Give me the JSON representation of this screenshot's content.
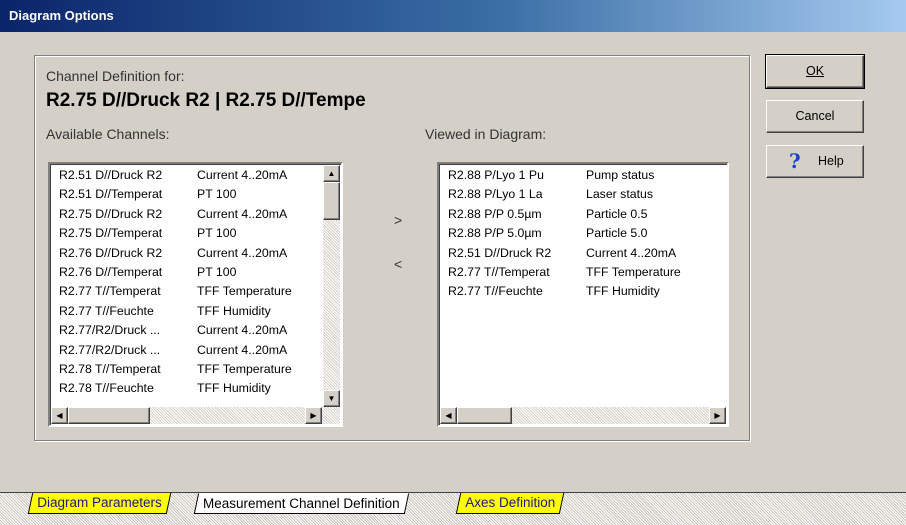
{
  "window": {
    "title": "Diagram Options"
  },
  "definition": {
    "label": "Channel Definition for:",
    "heading": "R2.75 D//Druck R2 | R2.75 D//Tempe"
  },
  "available": {
    "label": "Available Channels:",
    "rows": [
      {
        "name": "R2.51 D//Druck R2",
        "type": "Current 4..20mA"
      },
      {
        "name": "R2.51 D//Temperat",
        "type": "PT 100"
      },
      {
        "name": "R2.75 D//Druck R2",
        "type": "Current 4..20mA"
      },
      {
        "name": "R2.75 D//Temperat",
        "type": "PT 100"
      },
      {
        "name": "R2.76 D//Druck R2",
        "type": "Current 4..20mA"
      },
      {
        "name": "R2.76 D//Temperat",
        "type": "PT 100"
      },
      {
        "name": "R2.77 T//Temperat",
        "type": "TFF Temperature"
      },
      {
        "name": "R2.77 T//Feuchte",
        "type": "TFF Humidity"
      },
      {
        "name": "R2.77/R2/Druck ...",
        "type": "Current 4..20mA"
      },
      {
        "name": "R2.77/R2/Druck ...",
        "type": "Current 4..20mA"
      },
      {
        "name": "R2.78 T//Temperat",
        "type": "TFF Temperature"
      },
      {
        "name": "R2.78 T//Feuchte",
        "type": "TFF Humidity"
      }
    ]
  },
  "viewed": {
    "label": "Viewed in Diagram:",
    "rows": [
      {
        "name": "R2.88 P/Lyo 1 Pu",
        "type": "Pump status"
      },
      {
        "name": "R2.88 P/Lyo 1 La",
        "type": "Laser status"
      },
      {
        "name": "R2.88 P/P 0.5µm",
        "type": "Particle 0.5"
      },
      {
        "name": "R2.88 P/P 5.0µm",
        "type": "Particle 5.0"
      },
      {
        "name": "R2.51 D//Druck R2",
        "type": "Current 4..20mA"
      },
      {
        "name": "R2.77 T//Temperat",
        "type": "TFF Temperature"
      },
      {
        "name": "R2.77 T//Feuchte",
        "type": "TFF Humidity"
      }
    ]
  },
  "transfer": {
    "add": ">",
    "remove": "<"
  },
  "buttons": {
    "ok": "OK",
    "cancel": "Cancel",
    "help": "Help"
  },
  "tabs": [
    {
      "label": "Diagram Parameters"
    },
    {
      "label": "Measurement Channel Definition"
    },
    {
      "label": "Axes Definition"
    }
  ],
  "icons": {
    "help": "question-mark-icon"
  }
}
